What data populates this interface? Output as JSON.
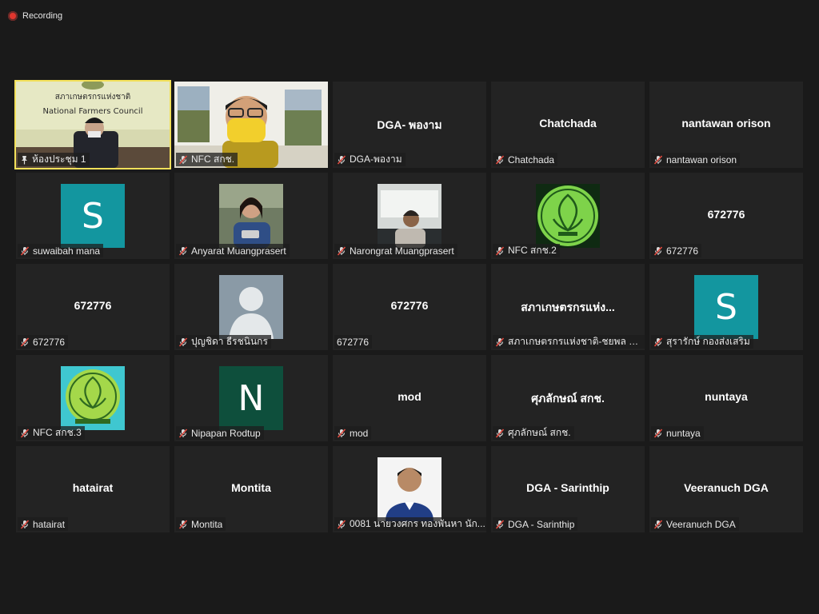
{
  "recording": {
    "label": "Recording",
    "color": "#e0362e"
  },
  "colors": {
    "tile_bg": "#232323",
    "page_bg": "#1a1a1a",
    "active_outline": "#f2e05a",
    "mic_muted": "#e04a3f",
    "teal_avatar": "#13969f",
    "green_avatar": "#0e4f3c"
  },
  "room_video": {
    "sign_th": "สภาเกษตรกรแห่งชาติ",
    "sign_en": "National Farmers Council"
  },
  "tiles": [
    {
      "name": "ห้องประชุม 1",
      "display": "",
      "kind": "video-room",
      "muted": false,
      "pinned": true,
      "active": true
    },
    {
      "name": "NFC สกช.",
      "display": "",
      "kind": "video-person",
      "muted": true
    },
    {
      "name": "DGA-พองาม",
      "display": "DGA- พองาม",
      "kind": "name",
      "muted": true
    },
    {
      "name": "Chatchada",
      "display": "Chatchada",
      "kind": "name",
      "muted": true
    },
    {
      "name": "nantawan orison",
      "display": "nantawan orison",
      "kind": "name",
      "muted": true
    },
    {
      "name": "suwaibah mana",
      "display": "",
      "kind": "letter",
      "letter": "S",
      "avatar_color": "#13969f",
      "muted": true
    },
    {
      "name": "Anyarat Muangprasert",
      "display": "",
      "kind": "photo-girl",
      "muted": true
    },
    {
      "name": "Narongrat Muangprasert",
      "display": "",
      "kind": "photo-man",
      "muted": true
    },
    {
      "name": "NFC สกช.2",
      "display": "",
      "kind": "logo-green",
      "muted": true
    },
    {
      "name": "672776",
      "display": "672776",
      "kind": "name",
      "muted": true
    },
    {
      "name": "672776",
      "display": "672776",
      "kind": "name",
      "muted": true
    },
    {
      "name": "ปุญชิดา ธีรชนินกร",
      "display": "",
      "kind": "default-avatar",
      "muted": true
    },
    {
      "name": "672776",
      "display": "672776",
      "kind": "name",
      "muted": false
    },
    {
      "name": "สภาเกษตรกรแห่งชาติ-ชยพล ถิลา",
      "display": "สภาเกษตรกรแห่ง...",
      "kind": "name",
      "muted": true
    },
    {
      "name": "สุรารักษ์ กองส่งเสริม",
      "display": "",
      "kind": "letter",
      "letter": "S",
      "avatar_color": "#13969f",
      "muted": true
    },
    {
      "name": "NFC สกช.3",
      "display": "",
      "kind": "logo-teal",
      "muted": true
    },
    {
      "name": "Nipapan Rodtup",
      "display": "",
      "kind": "letter",
      "letter": "N",
      "avatar_color": "#0e4f3c",
      "muted": true
    },
    {
      "name": "mod",
      "display": "mod",
      "kind": "name",
      "muted": true
    },
    {
      "name": "ศุภลักษณ์ สกช.",
      "display": "ศุภลักษณ์ สกช.",
      "kind": "name",
      "muted": true
    },
    {
      "name": "nuntaya",
      "display": "nuntaya",
      "kind": "name",
      "muted": true
    },
    {
      "name": "hatairat",
      "display": "hatairat",
      "kind": "name",
      "muted": true
    },
    {
      "name": "Montita",
      "display": "Montita",
      "kind": "name",
      "muted": true
    },
    {
      "name": "0081 นายวงศกร ทองพันหา นัก...",
      "display": "",
      "kind": "photo-blue",
      "muted": true
    },
    {
      "name": "DGA - Sarinthip",
      "display": "DGA - Sarinthip",
      "kind": "name",
      "muted": true
    },
    {
      "name": "Veeranuch DGA",
      "display": "Veeranuch DGA",
      "kind": "name",
      "muted": true
    }
  ]
}
